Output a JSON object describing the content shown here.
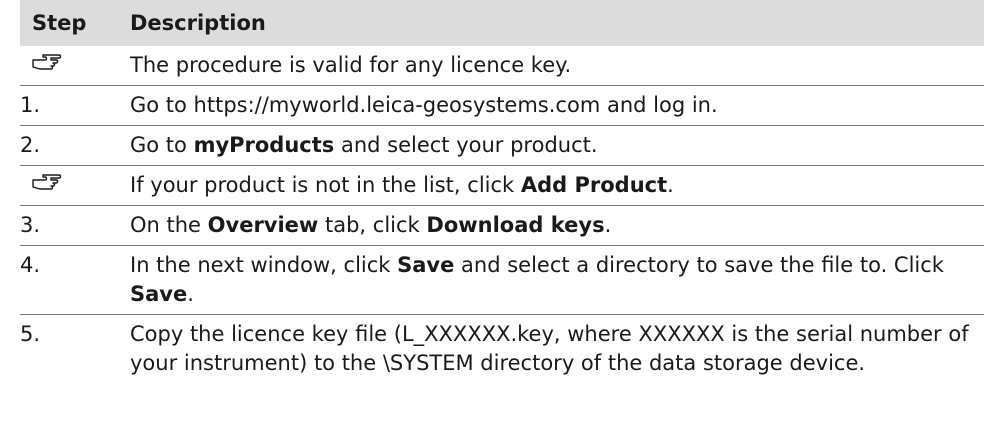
{
  "table": {
    "headers": {
      "step": "Step",
      "description": "Description"
    },
    "rows": [
      {
        "step": "",
        "icon": "pointing-hand-icon",
        "parts": [
          "The procedure is valid for any licence key."
        ]
      },
      {
        "step": "1.",
        "icon": "",
        "parts": [
          "Go to https://myworld.leica-geosystems.com and log in."
        ]
      },
      {
        "step": "2.",
        "icon": "",
        "parts": [
          "Go to ",
          "myProducts",
          " and select your product."
        ]
      },
      {
        "step": "",
        "icon": "pointing-hand-icon",
        "parts": [
          "If your product is not in the list, click ",
          "Add Product",
          "."
        ]
      },
      {
        "step": "3.",
        "icon": "",
        "parts": [
          "On the ",
          "Overview",
          " tab, click ",
          "Download keys",
          "."
        ]
      },
      {
        "step": "4.",
        "icon": "",
        "parts": [
          "In the next window, click ",
          "Save",
          " and select a directory to save the file to. Click ",
          "Save",
          "."
        ]
      },
      {
        "step": "5.",
        "icon": "",
        "parts": [
          "Copy the licence key file (L_XXXXXX.key, where XXXXXX is the serial number of your instrument) to the \\SYSTEM directory of the data storage device."
        ]
      }
    ]
  }
}
